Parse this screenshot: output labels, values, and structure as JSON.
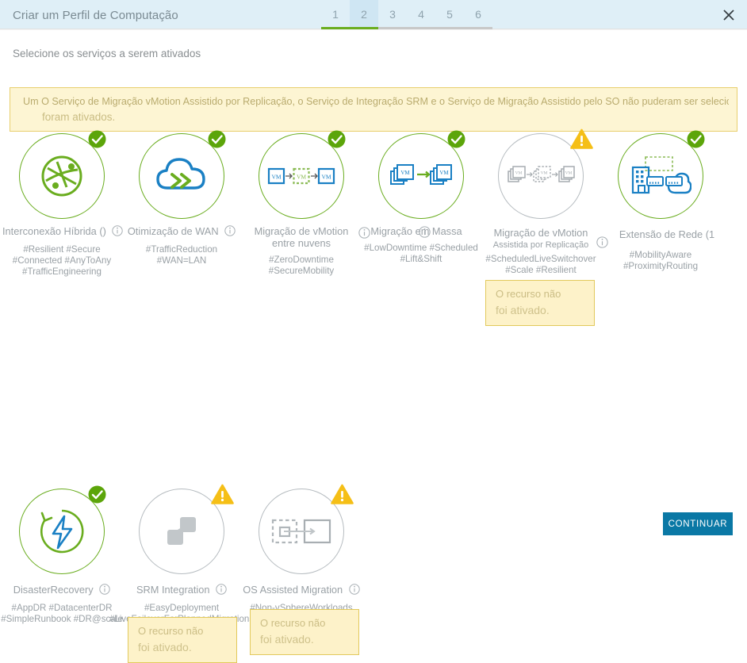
{
  "header": {
    "title": "Criar um Perfil de Computação",
    "steps": [
      "1",
      "2",
      "3",
      "4",
      "5",
      "6"
    ],
    "active_step": 2,
    "close_icon": "close-icon",
    "accent_green": "#6aad1f",
    "header_bg": "#dfeff7"
  },
  "subtitle": "Selecione os serviços a serem ativados",
  "banner": {
    "line1": "Um O Serviço de Migração vMotion Assistido por Replicação, o Serviço de Integração SRM e o Serviço de Migração Assistido pelo SO não puderam ser selecionados p",
    "line2": "foram ativados.",
    "bg": "#fdf5d3",
    "border": "#e8cf6e"
  },
  "tooltip_text": {
    "line1": "O recurso não",
    "line2": "foi ativado."
  },
  "cards": [
    {
      "id": "hybrid-interconnect",
      "title": "Interconexão Híbrida ()",
      "tags": "#Resilient #Secure\n#Connected #AnyToAny\n#TrafficEngineering",
      "status": "enabled",
      "badge": "check-badge-icon",
      "icon": "hybrid-interconnect-icon",
      "has_info": true,
      "tooltip": false
    },
    {
      "id": "wan-optimization",
      "title": "Otimização de WAN",
      "tags": "#TrafficReduction\n#WAN=LAN",
      "status": "enabled",
      "badge": "check-badge-icon",
      "icon": "wan-cloud-icon",
      "has_info": true,
      "tooltip": false
    },
    {
      "id": "cross-cloud-vmotion",
      "title": "Migração de vMotion\nentre nuvens",
      "tags": "#ZeroDowntime\n#SecureMobility",
      "status": "enabled",
      "badge": "check-badge-icon",
      "icon": "vm-migration-icon",
      "has_info": true,
      "tooltip": false
    },
    {
      "id": "bulk-migration",
      "title": "Migração em Massa",
      "tags": "#LowDowntime #Scheduled\n#Lift&Shift",
      "status": "enabled",
      "badge": "check-badge-icon",
      "icon": "bulk-vm-migration-icon",
      "has_info": true,
      "tooltip": false
    },
    {
      "id": "replication-assisted-vmotion",
      "title": "Migração de vMotion",
      "subtitle": "Assistida por Replicação",
      "tags": "#ScheduledLiveSwitchover\n#Scale #Resilient",
      "status": "disabled",
      "badge": "warning-badge-icon",
      "icon": "replication-vm-icon",
      "has_info": true,
      "tooltip": true
    },
    {
      "id": "network-extension",
      "title": "Extensão de Rede (1",
      "tags": "#MobilityAware\n#ProximityRouting",
      "status": "enabled",
      "badge": "check-badge-icon",
      "icon": "network-extension-icon",
      "has_info": false,
      "tooltip": false
    },
    {
      "id": "disaster-recovery",
      "title": "DisasterRecovery",
      "tags": "#AppDR #DatacenterDR\n#SimpleRunbook #DR@scale",
      "status": "enabled",
      "badge": "check-badge-icon",
      "icon": "disaster-recovery-icon",
      "has_info": true,
      "tooltip": false
    },
    {
      "id": "srm-integration",
      "title": "SRM Integration",
      "tags": "#EasyDeployment\n#LiveFailoverForPlannedMigrations\n#NetworkAware",
      "status": "disabled",
      "badge": "warning-badge-icon",
      "icon": "srm-nodes-icon",
      "has_info": true,
      "tooltip": true
    },
    {
      "id": "os-assisted-migration",
      "title": "OS Assisted Migration",
      "tags": "#Non-vSphereWorkloads\nmigration #Openstack",
      "status": "disabled",
      "badge": "warning-badge-icon",
      "icon": "os-assisted-migration-icon",
      "has_info": true,
      "tooltip": true
    }
  ],
  "footer": {
    "continue_label": "CONTINUAR",
    "continue_color": "#0a78a5"
  }
}
